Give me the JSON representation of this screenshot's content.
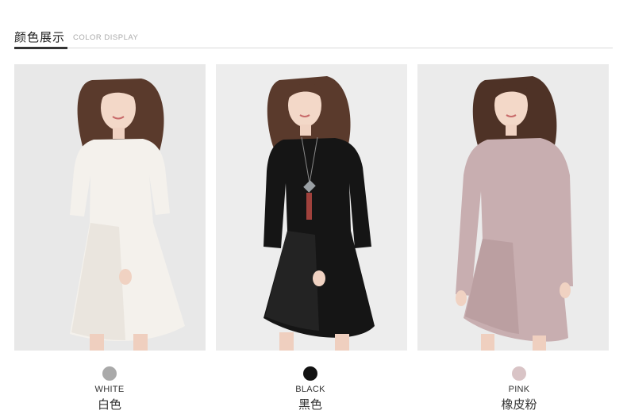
{
  "header": {
    "title": "颜色展示",
    "subtitle": "COLOR DISPLAY"
  },
  "colors": [
    {
      "label_en": "WHITE",
      "label_cn": "白色",
      "swatch": "#a9a9a9",
      "dress": "#f4f1ec",
      "dress_shade": "#e3ded6",
      "bg": "#eaeaea"
    },
    {
      "label_en": "BLACK",
      "label_cn": "黑色",
      "swatch": "#111111",
      "dress": "#151515",
      "dress_shade": "#2a2a2a",
      "bg": "#ededed"
    },
    {
      "label_en": "PINK",
      "label_cn": "橡皮粉",
      "swatch": "#d9c4c6",
      "dress": "#c8aeb0",
      "dress_shade": "#b39597",
      "bg": "#ebebeb"
    }
  ]
}
